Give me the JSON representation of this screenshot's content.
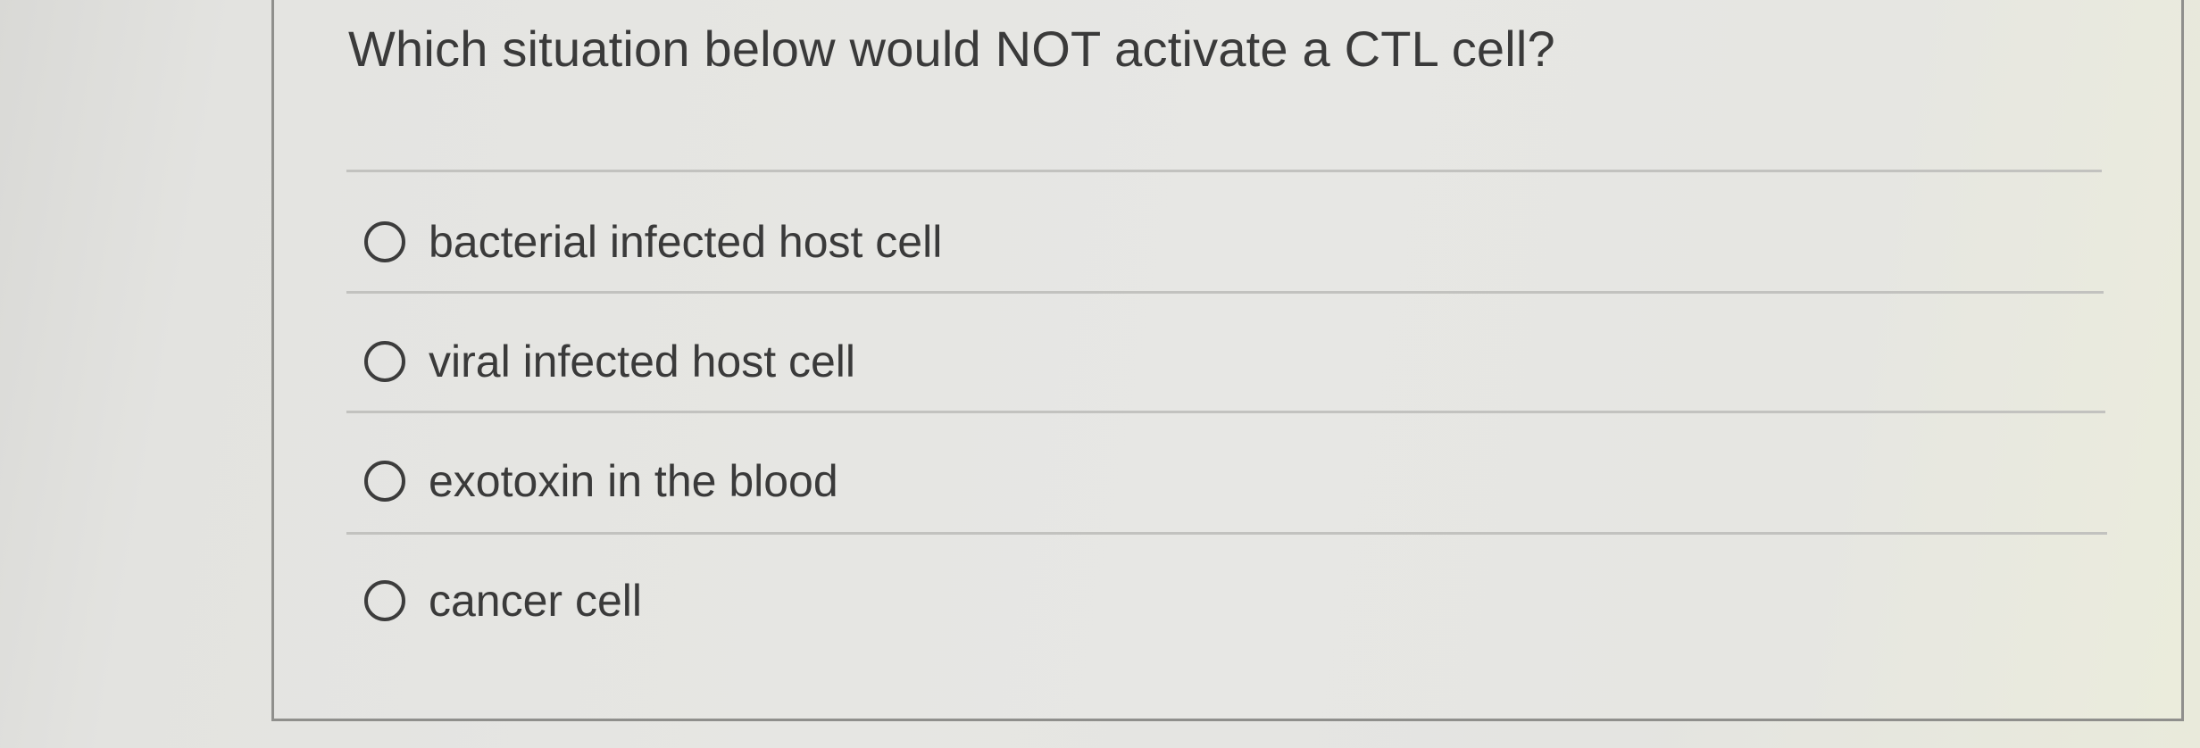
{
  "question": {
    "text": "Which situation below would NOT activate a CTL cell?"
  },
  "options": [
    {
      "label": "bacterial infected host cell",
      "selected": false
    },
    {
      "label": "viral infected host cell",
      "selected": false
    },
    {
      "label": "exotoxin in the blood",
      "selected": false
    },
    {
      "label": "cancer cell",
      "selected": false
    }
  ]
}
